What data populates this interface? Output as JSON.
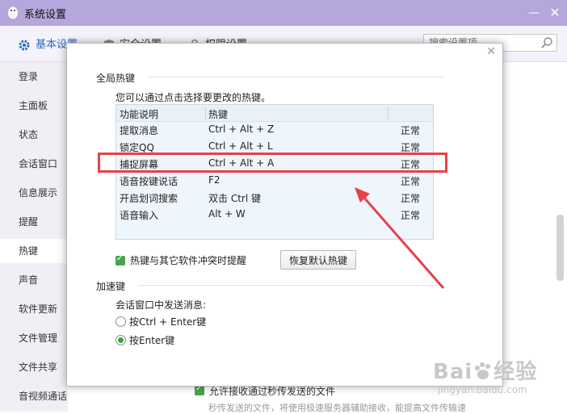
{
  "window": {
    "title": "系统设置"
  },
  "tabs": [
    {
      "label": "基本设置",
      "icon": "gear-icon"
    },
    {
      "label": "安全设置",
      "icon": "shield-icon"
    },
    {
      "label": "权限设置",
      "icon": "lock-icon"
    }
  ],
  "search": {
    "placeholder": "搜索设置项"
  },
  "sidebar": {
    "items": [
      "登录",
      "主面板",
      "状态",
      "会话窗口",
      "信息展示",
      "提醒",
      "热键",
      "声音",
      "软件更新",
      "文件管理",
      "文件共享",
      "音视频通话"
    ],
    "active": "热键"
  },
  "background": {
    "file_check_label": "允许接收通过秒传发送的文件",
    "file_sub_label": "秒传发送的文件，将使用极速服务器辅助接收，能提高文件传输速"
  },
  "dialog": {
    "global_section": "全局热键",
    "hint": "您可以通过点击选择要更改的热键。",
    "table": {
      "headers": [
        "功能说明",
        "热键"
      ],
      "rows": [
        {
          "name": "提取消息",
          "key": "Ctrl + Alt + Z",
          "status": "正常"
        },
        {
          "name": "锁定QQ",
          "key": "Ctrl + Alt + L",
          "status": "正常"
        },
        {
          "name": "捕捉屏幕",
          "key": "Ctrl + Alt + A",
          "status": "正常"
        },
        {
          "name": "语音按键说话",
          "key": "F2",
          "status": "正常"
        },
        {
          "name": "开启划词搜索",
          "key": "双击 Ctrl 键",
          "status": "正常"
        },
        {
          "name": "语音输入",
          "key": "Alt + W",
          "status": "正常"
        }
      ],
      "highlighted_row": "捕捉屏幕"
    },
    "conflict_label": "热键与其它软件冲突时提醒",
    "conflict_checked": true,
    "restore_button": "恢复默认热键",
    "accel_section": "加速键",
    "send_label": "会话窗口中发送消息:",
    "send_options": [
      {
        "label": "按Ctrl + Enter键",
        "selected": false
      },
      {
        "label": "按Enter键",
        "selected": true
      }
    ]
  },
  "watermark": {
    "brand": "Bai",
    "brand_cn": "经验",
    "url": "jingyan.baidu.com"
  },
  "colors": {
    "titlebar": "#b5a7dc",
    "accent": "#2a6bc5",
    "highlight": "#e8404a",
    "check": "#4aa54a"
  }
}
